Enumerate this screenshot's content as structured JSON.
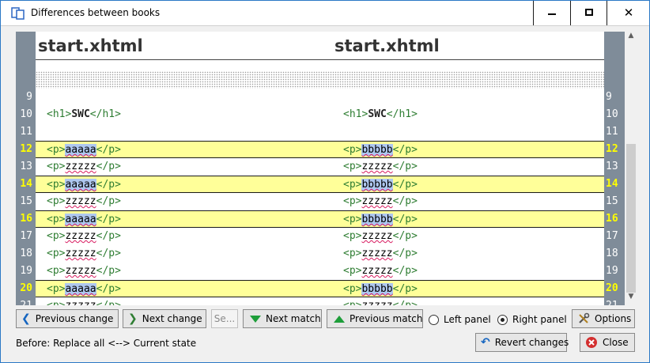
{
  "window": {
    "title": "Differences between books",
    "minimize": "minimize",
    "maximize": "maximize",
    "close": "✕"
  },
  "diff": {
    "left_file": "start.xhtml",
    "right_file": "start.xhtml",
    "lines": [
      {
        "num": "9",
        "changed": false,
        "left": [],
        "right": []
      },
      {
        "num": "10",
        "changed": false,
        "left": [
          {
            "t": "tag",
            "v": "<h1>"
          },
          {
            "t": "bold",
            "v": "SWC"
          },
          {
            "t": "tag",
            "v": "</h1>"
          }
        ],
        "right": [
          {
            "t": "tag",
            "v": "<h1>"
          },
          {
            "t": "bold",
            "v": "SWC"
          },
          {
            "t": "tag",
            "v": "</h1>"
          }
        ]
      },
      {
        "num": "11",
        "changed": false,
        "left": [],
        "right": []
      },
      {
        "num": "12",
        "changed": true,
        "left": [
          {
            "t": "tag",
            "v": "<p>"
          },
          {
            "t": "sel",
            "v": "aaaaa"
          },
          {
            "t": "tag",
            "v": "</p>"
          }
        ],
        "right": [
          {
            "t": "tag",
            "v": "<p>"
          },
          {
            "t": "sel",
            "v": "bbbbb"
          },
          {
            "t": "tag",
            "v": "</p>"
          }
        ]
      },
      {
        "num": "13",
        "changed": false,
        "left": [
          {
            "t": "tag",
            "v": "<p>"
          },
          {
            "t": "txt",
            "v": "zzzzz"
          },
          {
            "t": "tag",
            "v": "</p>"
          }
        ],
        "right": [
          {
            "t": "tag",
            "v": "<p>"
          },
          {
            "t": "txt",
            "v": "zzzzz"
          },
          {
            "t": "tag",
            "v": "</p>"
          }
        ]
      },
      {
        "num": "14",
        "changed": true,
        "left": [
          {
            "t": "tag",
            "v": "<p>"
          },
          {
            "t": "sel",
            "v": "aaaaa"
          },
          {
            "t": "tag",
            "v": "</p>"
          }
        ],
        "right": [
          {
            "t": "tag",
            "v": "<p>"
          },
          {
            "t": "sel",
            "v": "bbbbb"
          },
          {
            "t": "tag",
            "v": "</p>"
          }
        ]
      },
      {
        "num": "15",
        "changed": false,
        "left": [
          {
            "t": "tag",
            "v": "<p>"
          },
          {
            "t": "txt",
            "v": "zzzzz"
          },
          {
            "t": "tag",
            "v": "</p>"
          }
        ],
        "right": [
          {
            "t": "tag",
            "v": "<p>"
          },
          {
            "t": "txt",
            "v": "zzzzz"
          },
          {
            "t": "tag",
            "v": "</p>"
          }
        ]
      },
      {
        "num": "16",
        "changed": true,
        "left": [
          {
            "t": "tag",
            "v": "<p>"
          },
          {
            "t": "sel",
            "v": "aaaaa"
          },
          {
            "t": "tag",
            "v": "</p>"
          }
        ],
        "right": [
          {
            "t": "tag",
            "v": "<p>"
          },
          {
            "t": "sel",
            "v": "bbbbb"
          },
          {
            "t": "tag",
            "v": "</p>"
          }
        ]
      },
      {
        "num": "17",
        "changed": false,
        "left": [
          {
            "t": "tag",
            "v": "<p>"
          },
          {
            "t": "txt",
            "v": "zzzzz"
          },
          {
            "t": "tag",
            "v": "</p>"
          }
        ],
        "right": [
          {
            "t": "tag",
            "v": "<p>"
          },
          {
            "t": "txt",
            "v": "zzzzz"
          },
          {
            "t": "tag",
            "v": "</p>"
          }
        ]
      },
      {
        "num": "18",
        "changed": false,
        "left": [
          {
            "t": "tag",
            "v": "<p>"
          },
          {
            "t": "txt",
            "v": "zzzzz"
          },
          {
            "t": "tag",
            "v": "</p>"
          }
        ],
        "right": [
          {
            "t": "tag",
            "v": "<p>"
          },
          {
            "t": "txt",
            "v": "zzzzz"
          },
          {
            "t": "tag",
            "v": "</p>"
          }
        ]
      },
      {
        "num": "19",
        "changed": false,
        "left": [
          {
            "t": "tag",
            "v": "<p>"
          },
          {
            "t": "txt",
            "v": "zzzzz"
          },
          {
            "t": "tag",
            "v": "</p>"
          }
        ],
        "right": [
          {
            "t": "tag",
            "v": "<p>"
          },
          {
            "t": "txt",
            "v": "zzzzz"
          },
          {
            "t": "tag",
            "v": "</p>"
          }
        ]
      },
      {
        "num": "20",
        "changed": true,
        "left": [
          {
            "t": "tag",
            "v": "<p>"
          },
          {
            "t": "sel",
            "v": "aaaaa"
          },
          {
            "t": "tag",
            "v": "</p>"
          }
        ],
        "right": [
          {
            "t": "tag",
            "v": "<p>"
          },
          {
            "t": "sel",
            "v": "bbbbb"
          },
          {
            "t": "tag",
            "v": "</p>"
          }
        ]
      },
      {
        "num": "21",
        "changed": false,
        "left": [
          {
            "t": "tag",
            "v": "<p>"
          },
          {
            "t": "txt",
            "v": "zzzzz"
          },
          {
            "t": "tag",
            "v": "</p>"
          }
        ],
        "right": [
          {
            "t": "tag",
            "v": "<p>"
          },
          {
            "t": "txt",
            "v": "zzzzz"
          },
          {
            "t": "tag",
            "v": "</p>"
          }
        ]
      }
    ]
  },
  "toolbar": {
    "previous_change": "Previous change",
    "next_change": "Next change",
    "search": "Se...",
    "next_match": "Next match",
    "previous_match": "Previous match",
    "left_panel": "Left panel",
    "right_panel": "Right panel",
    "options": "Options",
    "selected_panel": "right"
  },
  "footer": {
    "status": "Before: Replace all <--> Current state",
    "revert": "Revert changes",
    "close": "Close"
  },
  "colors": {
    "highlight_row": "#ffff99",
    "gutter": "#7f8c99",
    "changed_line_number": "#ffff00",
    "tag": "#2e7d32",
    "selection": "#aec7ef"
  },
  "icons": {
    "app": "book-diff-icon",
    "previous_change": "arrow-left-icon",
    "next_change": "arrow-right-icon",
    "next_match": "triangle-down-icon",
    "previous_match": "triangle-up-icon",
    "options": "tools-icon",
    "revert": "undo-arrow-icon",
    "close": "red-x-icon"
  }
}
